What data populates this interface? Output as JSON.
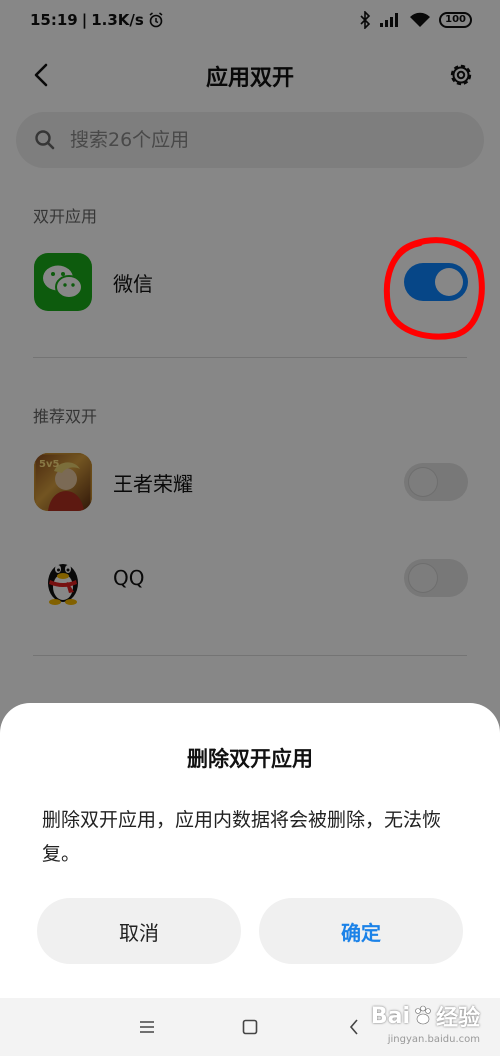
{
  "status_bar": {
    "time": "15:19",
    "speed": "1.3K/s",
    "battery": "100"
  },
  "header": {
    "title": "应用双开"
  },
  "search": {
    "placeholder": "搜索26个应用"
  },
  "sections": {
    "dual_apps_label": "双开应用",
    "recommended_label": "推荐双开"
  },
  "apps": {
    "wechat": {
      "name": "微信",
      "enabled": true
    },
    "honor_of_kings": {
      "name": "王者荣耀",
      "enabled": false
    },
    "qq": {
      "name": "QQ",
      "enabled": false
    }
  },
  "dialog": {
    "title": "删除双开应用",
    "message": "删除双开应用，应用内数据将会被删除，无法恢复。",
    "cancel_label": "取消",
    "confirm_label": "确定"
  },
  "watermark": {
    "brand": "Bai",
    "suffix": "经验",
    "url": "jingyan.baidu.com"
  },
  "colors": {
    "accent": "#0d84ff",
    "confirm_text": "#1b82e8",
    "annotation": "#ff0000",
    "wechat_green": "#1aad19"
  }
}
